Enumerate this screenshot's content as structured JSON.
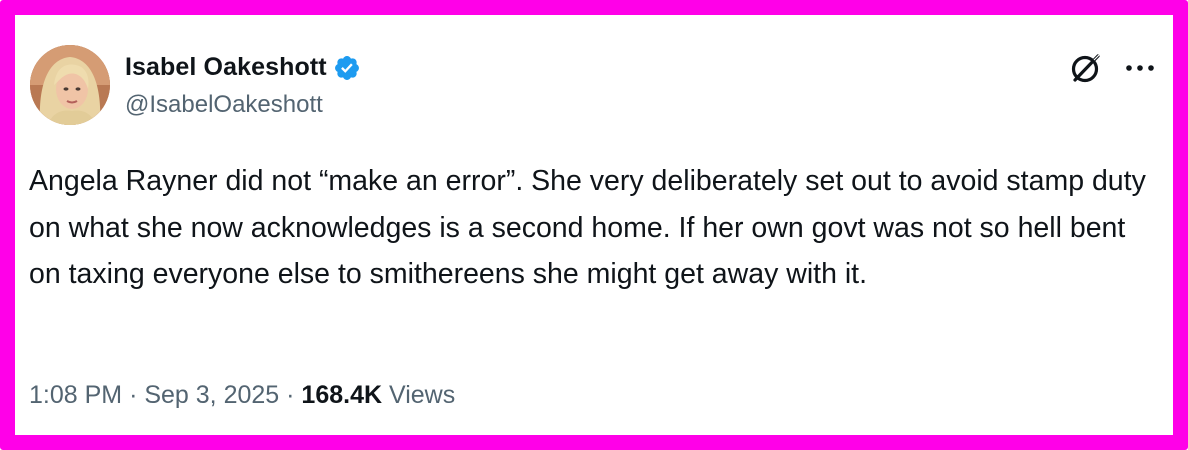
{
  "author": {
    "display_name": "Isabel Oakeshott",
    "handle": "@IsabelOakeshott",
    "verified": true
  },
  "tweet": {
    "text": "Angela Rayner did not “make an error”. She very deliberately set out to avoid stamp duty on what she now acknowledges is a second home. If her own govt was not so hell bent on taxing everyone else to smithereens she might get away with it."
  },
  "meta": {
    "time": "1:08 PM",
    "separator": "·",
    "date": "Sep 3, 2025",
    "views_count": "168.4K",
    "views_label": "Views"
  },
  "icons": {
    "grok": "grok-icon",
    "more": "more-icon",
    "verified": "verified-badge-icon"
  },
  "colors": {
    "frame_border": "#ff00e8",
    "text_primary": "#0f1419",
    "text_secondary": "#536471",
    "verified_blue": "#1d9bf0"
  }
}
